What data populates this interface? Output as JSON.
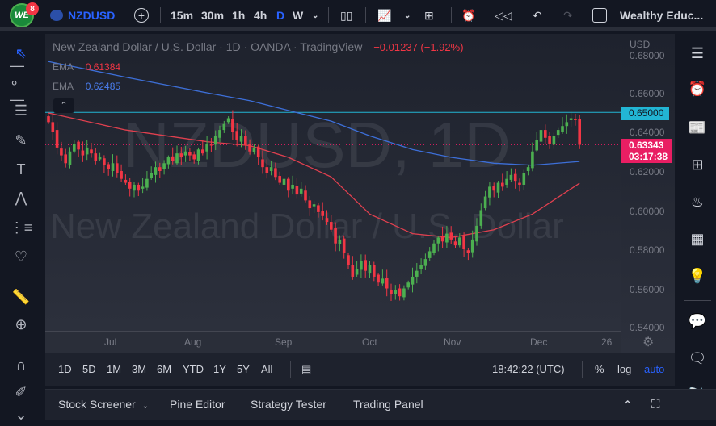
{
  "topbar": {
    "notif_count": "8",
    "symbol": "NZDUSD",
    "intervals": [
      "15m",
      "30m",
      "1h",
      "4h",
      "D",
      "W"
    ],
    "active_interval": "D",
    "account": "Wealthy Educ..."
  },
  "legend": {
    "title": "New Zealand Dollar / U.S. Dollar · 1D · OANDA · TradingView",
    "change": "−0.01237 (−1.92%)",
    "ema1_label": "EMA",
    "ema1_value": "0.61384",
    "ema2_label": "EMA",
    "ema2_value": "0.62485"
  },
  "watermark": {
    "line1": "NZDUSD, 1D",
    "line2": "New Zealand Dollar / U.S. Dollar"
  },
  "price_axis": {
    "currency": "USD",
    "labels": [
      "0.68000",
      "0.66000",
      "0.64000",
      "0.62000",
      "0.60000",
      "0.58000",
      "0.56000",
      "0.54000"
    ],
    "line_label": "0.65000",
    "last_price": "0.63343",
    "countdown": "03:17:38"
  },
  "time_axis": {
    "labels": [
      "Jul",
      "Aug",
      "Sep",
      "Oct",
      "Nov",
      "Dec",
      "26"
    ]
  },
  "range": {
    "buttons": [
      "1D",
      "5D",
      "1M",
      "3M",
      "6M",
      "YTD",
      "1Y",
      "5Y",
      "All"
    ],
    "time": "18:42:22 (UTC)",
    "percent": "%",
    "log": "log",
    "auto": "auto"
  },
  "bottom": {
    "tabs": [
      "Stock Screener",
      "Pine Editor",
      "Strategy Tester",
      "Trading Panel"
    ]
  },
  "colors": {
    "up": "#26a69a",
    "bull": "#4caf50",
    "bear": "#f23645",
    "ema_fast": "#e0404f",
    "ema_slow": "#3d6fd8",
    "hline": "#22b5d4",
    "accent": "#2962ff"
  },
  "chart_data": {
    "type": "candlestick",
    "symbol": "NZDUSD",
    "timeframe": "1D",
    "ylim": [
      0.54,
      0.68
    ],
    "closes": [
      0.645,
      0.64,
      0.632,
      0.628,
      0.624,
      0.63,
      0.634,
      0.631,
      0.628,
      0.632,
      0.629,
      0.625,
      0.627,
      0.623,
      0.621,
      0.624,
      0.619,
      0.616,
      0.614,
      0.611,
      0.613,
      0.61,
      0.612,
      0.616,
      0.619,
      0.622,
      0.62,
      0.624,
      0.627,
      0.625,
      0.629,
      0.627,
      0.63,
      0.628,
      0.626,
      0.631,
      0.629,
      0.634,
      0.633,
      0.638,
      0.641,
      0.644,
      0.647,
      0.64,
      0.636,
      0.638,
      0.633,
      0.63,
      0.632,
      0.627,
      0.622,
      0.619,
      0.622,
      0.617,
      0.614,
      0.616,
      0.61,
      0.613,
      0.608,
      0.611,
      0.605,
      0.601,
      0.603,
      0.599,
      0.597,
      0.594,
      0.59,
      0.583,
      0.585,
      0.578,
      0.572,
      0.566,
      0.57,
      0.574,
      0.569,
      0.572,
      0.566,
      0.563,
      0.565,
      0.56,
      0.557,
      0.559,
      0.556,
      0.56,
      0.563,
      0.566,
      0.569,
      0.572,
      0.575,
      0.579,
      0.583,
      0.586,
      0.584,
      0.588,
      0.585,
      0.582,
      0.586,
      0.58,
      0.578,
      0.585,
      0.592,
      0.6,
      0.607,
      0.612,
      0.61,
      0.614,
      0.612,
      0.616,
      0.618,
      0.615,
      0.613,
      0.619,
      0.622,
      0.63,
      0.636,
      0.641,
      0.637,
      0.634,
      0.638,
      0.641,
      0.643,
      0.645,
      0.647,
      0.646,
      0.6334
    ],
    "ema_fast": {
      "idx": [
        0,
        18,
        37,
        47,
        56,
        66,
        75,
        85,
        94,
        104,
        113,
        124
      ],
      "values": [
        0.6497,
        0.641,
        0.635,
        0.633,
        0.627,
        0.617,
        0.598,
        0.588,
        0.586,
        0.59,
        0.598,
        0.6138
      ]
    },
    "ema_slow": {
      "idx": [
        0,
        18,
        37,
        47,
        56,
        66,
        75,
        85,
        94,
        104,
        113,
        124
      ],
      "values": [
        0.676,
        0.668,
        0.66,
        0.656,
        0.651,
        0.6455,
        0.638,
        0.631,
        0.627,
        0.624,
        0.623,
        0.6249
      ]
    },
    "hline": 0.65,
    "last": 0.63343
  }
}
